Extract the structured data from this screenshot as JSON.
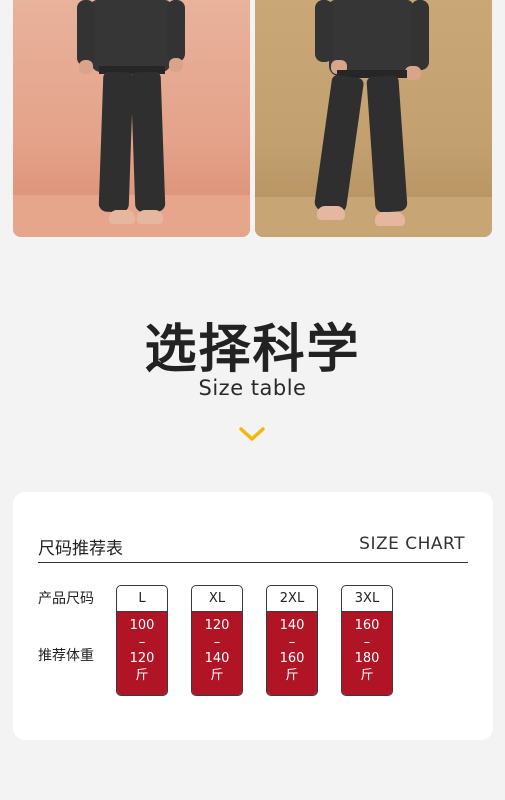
{
  "heading": {
    "title_cn": "选择科学",
    "title_en": "Size table"
  },
  "icons": {
    "chevron": "chevron-down-icon",
    "chevron_color": "#f2b70d"
  },
  "size_chart": {
    "title": "尺码推荐表",
    "title_en": "SIZE CHART",
    "row_labels": {
      "size": "产品尺码",
      "weight": "推荐体重"
    },
    "accent_color": "#b01425",
    "columns": [
      {
        "size": "L",
        "from": "100",
        "dash": "–",
        "to": "120",
        "unit": "斤"
      },
      {
        "size": "XL",
        "from": "120",
        "dash": "–",
        "to": "140",
        "unit": "斤"
      },
      {
        "size": "2XL",
        "from": "140",
        "dash": "–",
        "to": "160",
        "unit": "斤"
      },
      {
        "size": "3XL",
        "from": "160",
        "dash": "–",
        "to": "180",
        "unit": "斤"
      }
    ]
  }
}
